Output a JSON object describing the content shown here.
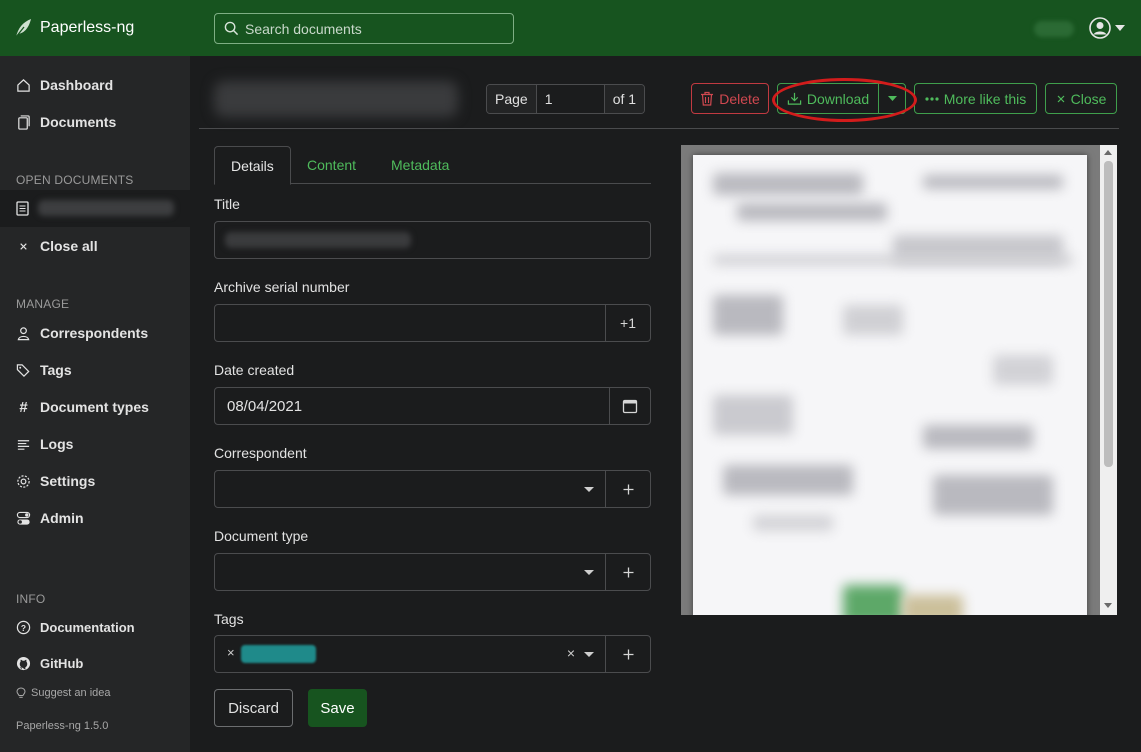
{
  "app": {
    "name": "Paperless-ng",
    "version": "Paperless-ng 1.5.0"
  },
  "search": {
    "placeholder": "Search documents"
  },
  "sidebar": {
    "dashboard": "Dashboard",
    "documents": "Documents",
    "open_documents_heading": "OPEN DOCUMENTS",
    "close_all": "Close all",
    "manage_heading": "MANAGE",
    "correspondents": "Correspondents",
    "tags": "Tags",
    "document_types": "Document types",
    "logs": "Logs",
    "settings": "Settings",
    "admin": "Admin",
    "info_heading": "INFO",
    "documentation": "Documentation",
    "github": "GitHub",
    "suggest": "Suggest an idea"
  },
  "pager": {
    "page_label": "Page",
    "page_value": "1",
    "of_label": "of 1"
  },
  "toolbar": {
    "delete": "Delete",
    "download": "Download",
    "more_like_this": "More like this",
    "close": "Close"
  },
  "tabs": {
    "details": "Details",
    "content": "Content",
    "metadata": "Metadata"
  },
  "form": {
    "title_label": "Title",
    "asn_label": "Archive serial number",
    "asn_addon": "+1",
    "asn_value": "",
    "date_label": "Date created",
    "date_value": "08/04/2021",
    "correspondent_label": "Correspondent",
    "document_type_label": "Document type",
    "tags_label": "Tags",
    "discard": "Discard",
    "save": "Save"
  },
  "colors": {
    "topbar": "#17541f",
    "accent": "#4fbb5c",
    "danger": "#d04850",
    "highlight": "#d31c1c",
    "tag_chip": "#1f8a8a"
  }
}
